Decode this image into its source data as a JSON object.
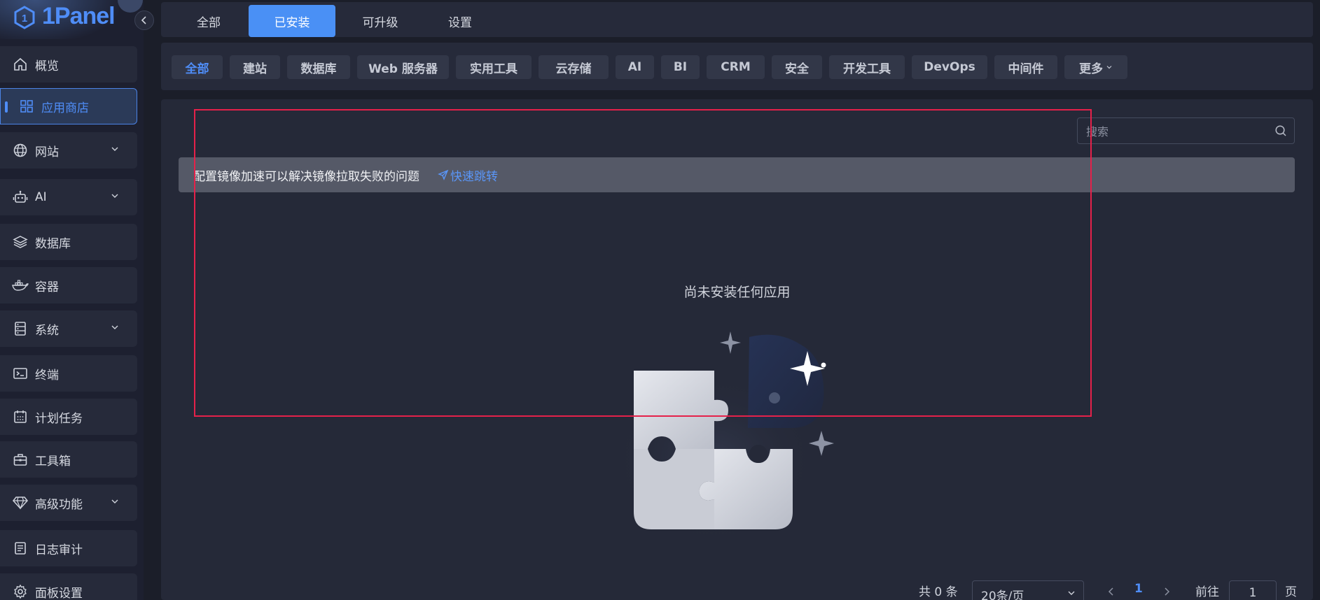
{
  "brand": {
    "name": "1Panel"
  },
  "sidebar": {
    "items": [
      {
        "label": "概览",
        "icon": "home-icon"
      },
      {
        "label": "应用商店",
        "icon": "apps-grid-icon",
        "active": true
      },
      {
        "label": "网站",
        "icon": "globe-icon",
        "expandable": true
      },
      {
        "label": "AI",
        "icon": "robot-icon",
        "expandable": true
      },
      {
        "label": "数据库",
        "icon": "layers-icon"
      },
      {
        "label": "容器",
        "icon": "docker-icon"
      },
      {
        "label": "系统",
        "icon": "server-icon",
        "expandable": true
      },
      {
        "label": "终端",
        "icon": "terminal-icon"
      },
      {
        "label": "计划任务",
        "icon": "calendar-icon"
      },
      {
        "label": "工具箱",
        "icon": "toolbox-icon"
      },
      {
        "label": "高级功能",
        "icon": "diamond-icon",
        "expandable": true
      },
      {
        "label": "日志审计",
        "icon": "log-icon"
      },
      {
        "label": "面板设置",
        "icon": "gear-icon"
      }
    ]
  },
  "tabs": [
    {
      "label": "全部"
    },
    {
      "label": "已安装",
      "active": true
    },
    {
      "label": "可升级"
    },
    {
      "label": "设置"
    }
  ],
  "categories": [
    {
      "label": "全部",
      "active": true
    },
    {
      "label": "建站"
    },
    {
      "label": "数据库"
    },
    {
      "label": "Web 服务器"
    },
    {
      "label": "实用工具"
    },
    {
      "label": "云存储"
    },
    {
      "label": "AI"
    },
    {
      "label": "BI"
    },
    {
      "label": "CRM"
    },
    {
      "label": "安全"
    },
    {
      "label": "开发工具"
    },
    {
      "label": "DevOps"
    },
    {
      "label": "中间件"
    },
    {
      "label": "更多"
    }
  ],
  "search": {
    "placeholder": "搜索"
  },
  "notice": {
    "text": "配置镜像加速可以解决镜像拉取失败的问题",
    "link": "快速跳转"
  },
  "empty": {
    "text": "尚未安装任何应用"
  },
  "pagination": {
    "total": "共 0 条",
    "page_size": "20条/页",
    "current_page": "1",
    "goto_label": "前往",
    "goto_value": "1",
    "page_suffix": "页"
  },
  "colors": {
    "accent": "#4a90f5",
    "highlight": "#e5214a",
    "background": "#1b1e29"
  }
}
